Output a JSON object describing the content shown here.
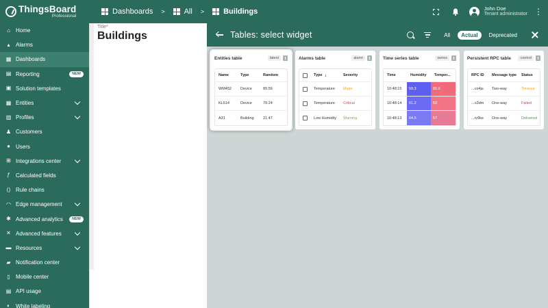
{
  "app": {
    "logo_name": "ThingsBoard",
    "logo_sub": "Professional"
  },
  "breadcrumbs": [
    {
      "label": "Dashboards",
      "icon": "grid-icon"
    },
    {
      "label": "All",
      "icon": "grid-icon"
    },
    {
      "label": "Buildings",
      "icon": "grid-icon"
    }
  ],
  "breadcrumb_separator": ">",
  "user": {
    "name": "John Doe",
    "role": "Tenant administrator"
  },
  "sidebar": {
    "items": [
      {
        "label": "Home",
        "icon": "home-icon",
        "glyph": "⌂"
      },
      {
        "label": "Alarms",
        "icon": "bell-icon",
        "glyph": "▴"
      },
      {
        "label": "Dashboards",
        "icon": "dashboard-icon",
        "glyph": "▦",
        "active": true
      },
      {
        "label": "Reporting",
        "icon": "report-icon",
        "glyph": "▤",
        "badge": "NEW"
      },
      {
        "label": "Solution templates",
        "icon": "templates-icon",
        "glyph": "▣"
      },
      {
        "label": "Entities",
        "icon": "entities-icon",
        "glyph": "▦",
        "expandable": true
      },
      {
        "label": "Profiles",
        "icon": "profiles-icon",
        "glyph": "▥",
        "expandable": true
      },
      {
        "label": "Customers",
        "icon": "customers-icon",
        "glyph": "♟"
      },
      {
        "label": "Users",
        "icon": "user-icon",
        "glyph": "●"
      },
      {
        "label": "Integrations center",
        "icon": "integrations-icon",
        "glyph": "⊞",
        "expandable": true
      },
      {
        "label": "Calculated fields",
        "icon": "function-icon",
        "glyph": "ƒ"
      },
      {
        "label": "Rule chains",
        "icon": "code-icon",
        "glyph": "⟨⟩"
      },
      {
        "label": "Edge management",
        "icon": "edge-icon",
        "glyph": "◠",
        "expandable": true
      },
      {
        "label": "Advanced analytics",
        "icon": "analytics-icon",
        "glyph": "✱",
        "badge": "NEW"
      },
      {
        "label": "Advanced features",
        "icon": "tools-icon",
        "glyph": "✕",
        "expandable": true
      },
      {
        "label": "Resources",
        "icon": "folder-icon",
        "glyph": "▬",
        "expandable": true
      },
      {
        "label": "Notification center",
        "icon": "notification-icon",
        "glyph": "▰"
      },
      {
        "label": "Mobile center",
        "icon": "mobile-icon",
        "glyph": "▯"
      },
      {
        "label": "API usage",
        "icon": "api-icon",
        "glyph": "▤"
      },
      {
        "label": "White labeling",
        "icon": "palette-icon",
        "glyph": "◐"
      }
    ]
  },
  "content": {
    "title_label": "Title*",
    "title_value": "Buildings"
  },
  "dialog": {
    "title": "Tables: select widget",
    "filters": [
      {
        "label": "All",
        "active": false
      },
      {
        "label": "Actual",
        "active": true
      },
      {
        "label": "Deprecated",
        "active": false
      }
    ]
  },
  "widgets": [
    {
      "title": "Entities table",
      "tag": "latest",
      "selected": true,
      "columns": [
        "Name",
        "Type",
        "Random"
      ],
      "rows": [
        [
          "WM452",
          "Device",
          "89.56"
        ],
        [
          "KL514",
          "Device",
          "79.24"
        ],
        [
          "A31",
          "Building",
          "21.47"
        ]
      ]
    },
    {
      "title": "Alarms table",
      "tag": "alarm",
      "columns": [
        "Type",
        "Severity"
      ],
      "rows": [
        [
          "Temperature",
          "Major"
        ],
        [
          "Temperature",
          "Critical"
        ],
        [
          "Low Humidity",
          "Warning"
        ]
      ]
    },
    {
      "title": "Time series table",
      "tag": "series",
      "columns": [
        "Time",
        "Humidity",
        "Temper..."
      ],
      "rows": [
        [
          "10:48:15",
          "59.3",
          "85.6"
        ],
        [
          "10:48:14",
          "61.2",
          "52"
        ],
        [
          "10:48:13",
          "64.5",
          "57"
        ]
      ]
    },
    {
      "title": "Persistent RPC table",
      "tag": "control",
      "columns": [
        "RPC ID",
        "Message type",
        "Status"
      ],
      "rows": [
        [
          "...co4ju",
          "Two-way",
          "Timeout"
        ],
        [
          "...o3dm",
          "One-way",
          "Failed"
        ],
        [
          "...rv9ke",
          "One-way",
          "Delivered"
        ]
      ]
    }
  ],
  "colors": {
    "primary": "#2a6b5c",
    "severity_major": "#f5a623",
    "severity_critical": "#e53935",
    "severity_warning": "#7cb342",
    "status_timeout": "#f5a623",
    "status_failed": "#e53935",
    "status_delivered": "#43a047",
    "humidity_cell": "#5e5ef0",
    "temperature_cell": "#f06a7a"
  }
}
